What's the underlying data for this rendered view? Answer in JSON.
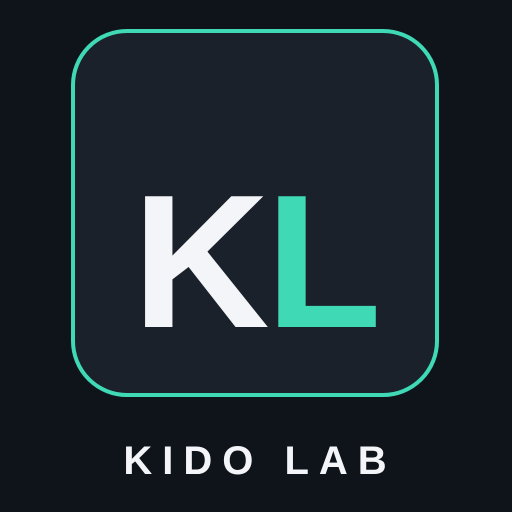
{
  "logo": {
    "monogram_first": "K",
    "monogram_second": "L",
    "wordmark": "KIDO LAB"
  },
  "colors": {
    "background": "#0f141b",
    "tile": "#1a212b",
    "accent": "#40d9b6",
    "foreground": "#f4f5f8"
  }
}
